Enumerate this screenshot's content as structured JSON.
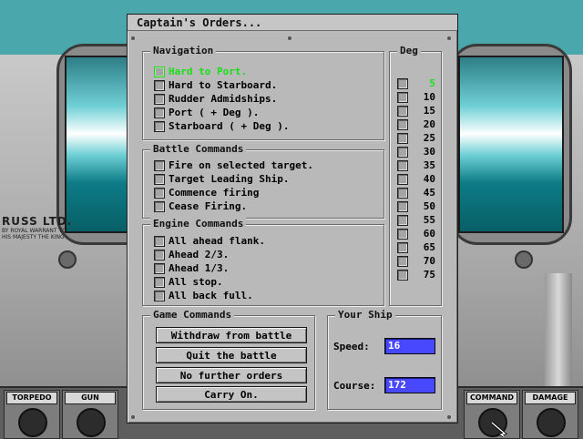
{
  "dialog": {
    "title": "Captain's Orders..."
  },
  "navigation": {
    "title": "Navigation",
    "options": [
      {
        "label": "Hard to Port.",
        "selected": true
      },
      {
        "label": "Hard to Starboard.",
        "selected": false
      },
      {
        "label": "Rudder Admidships.",
        "selected": false
      },
      {
        "label": "Port ( + Deg ).",
        "selected": false
      },
      {
        "label": "Starboard ( + Deg ).",
        "selected": false
      }
    ]
  },
  "battle": {
    "title": "Battle Commands",
    "options": [
      {
        "label": "Fire on selected target."
      },
      {
        "label": "Target Leading Ship."
      },
      {
        "label": "Commence firing"
      },
      {
        "label": "Cease Firing."
      }
    ]
  },
  "engine": {
    "title": "Engine Commands",
    "options": [
      {
        "label": "All ahead flank."
      },
      {
        "label": "Ahead 2/3."
      },
      {
        "label": "Ahead 1/3."
      },
      {
        "label": "All stop."
      },
      {
        "label": "All back full."
      }
    ]
  },
  "degrees": {
    "title": "Deg",
    "values": [
      "5",
      "10",
      "15",
      "20",
      "25",
      "30",
      "35",
      "40",
      "45",
      "50",
      "55",
      "60",
      "65",
      "70",
      "75"
    ],
    "selected_index": 0
  },
  "game": {
    "title": "Game Commands",
    "buttons": [
      "Withdraw from battle",
      "Quit the battle",
      "No further orders",
      "Carry On."
    ]
  },
  "ship": {
    "title": "Your Ship",
    "speed_label": "Speed:",
    "speed_value": "16",
    "course_label": "Course:",
    "course_value": "172"
  },
  "toolbar": {
    "slots": [
      {
        "label": "TORPEDO"
      },
      {
        "label": "GUN"
      },
      {
        "label": "COMMAND"
      },
      {
        "label": "DAMAGE"
      }
    ]
  },
  "background": {
    "maker_line1": "RUSS LTD.",
    "maker_line2": "BY ROYAL WARRANT TO HIS MAJESTY THE KING"
  },
  "colors": {
    "highlight": "#18e018",
    "field_bg": "#4848ff",
    "panel": "#b9b9b9",
    "water": "#4aa8ac"
  }
}
